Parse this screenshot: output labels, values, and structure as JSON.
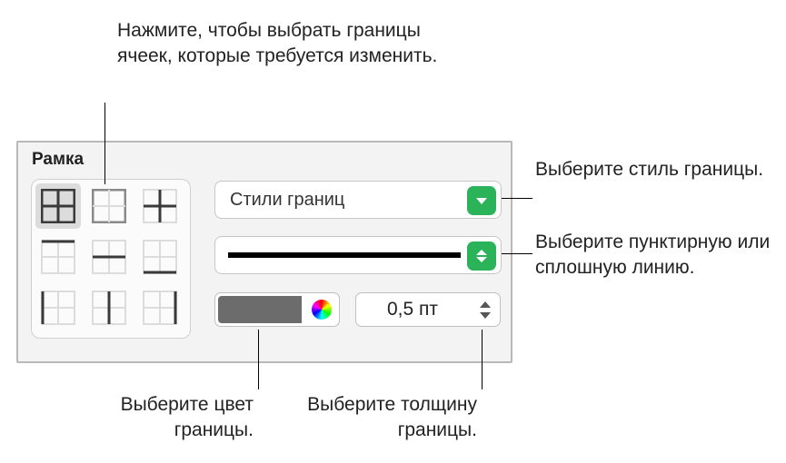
{
  "annotations": {
    "top": "Нажмите, чтобы выбрать границы ячеек, которые требуется изменить.",
    "style": "Выберите стиль границы.",
    "dashed": "Выберите пунктирную или сплошную линию.",
    "color": "Выберите цвет границы.",
    "thickness": "Выберите толщину границы."
  },
  "panel": {
    "title": "Рамка",
    "styles_label": "Стили границ",
    "thickness_value": "0,5 пт"
  }
}
